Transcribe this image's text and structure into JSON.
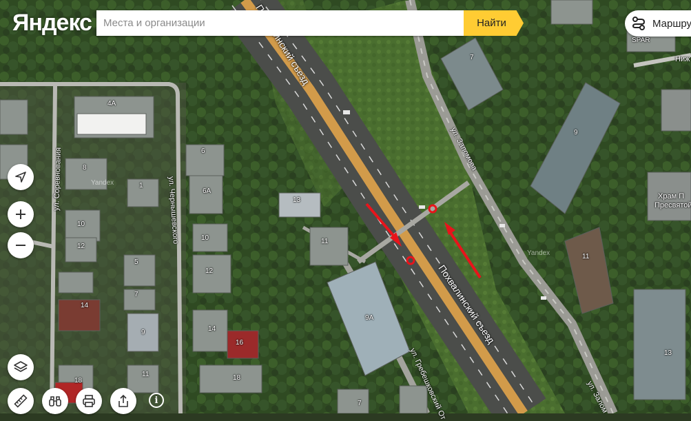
{
  "header": {
    "logo": "Яндекс",
    "search_placeholder": "Места и организации",
    "find_label": "Найти",
    "route_label": "Маршру"
  },
  "map": {
    "streets": {
      "sorevnovaniya": "ул. Соревнования",
      "chernyshevskogo": "ул. Чернышевского",
      "zalomova": "ул. Заломова",
      "zalomova_bottom": "ул. Залом",
      "grebeshkovsky": "ул. Гребешковский От",
      "pokhvalinsky": "Похвалинский съезд",
      "pokhvalinsky_top": "Похвалинский съезд",
      "nizh": "Ниж"
    },
    "buildings": [
      "4А",
      "8",
      "1",
      "6",
      "6А",
      "10",
      "10",
      "12",
      "12",
      "5",
      "7",
      "14",
      "9",
      "14",
      "16",
      "18",
      "11",
      "18",
      "13",
      "11",
      "9А",
      "7",
      "9",
      "11",
      "13"
    ],
    "poi": {
      "spar": "SPAR",
      "church_line1": "Храм П",
      "church_line2": "Пресвятой"
    },
    "watermarks": [
      "Yandex",
      "Yandex"
    ],
    "accent": "#ffcc33",
    "marker_color": "#e8141b"
  },
  "controls": {
    "navigate_icon": "navigation-arrow-icon",
    "zoom_in_icon": "plus-icon",
    "zoom_out_icon": "minus-icon",
    "layers_icon": "layers-icon",
    "ruler_icon": "ruler-icon",
    "panorama_icon": "binoculars-icon",
    "print_icon": "printer-icon",
    "share_icon": "share-icon",
    "info_label": "i"
  }
}
